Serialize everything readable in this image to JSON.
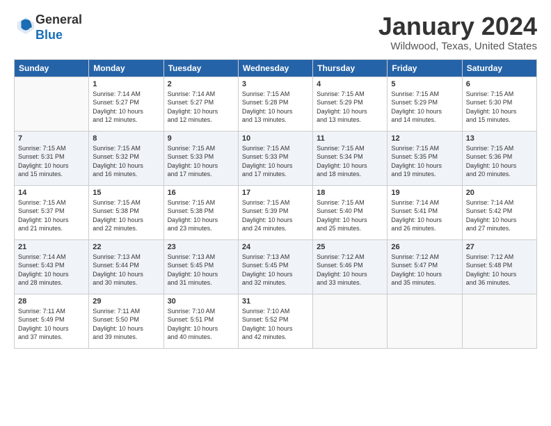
{
  "logo": {
    "general": "General",
    "blue": "Blue"
  },
  "title": "January 2024",
  "subtitle": "Wildwood, Texas, United States",
  "weekdays": [
    "Sunday",
    "Monday",
    "Tuesday",
    "Wednesday",
    "Thursday",
    "Friday",
    "Saturday"
  ],
  "weeks": [
    [
      {
        "day": "",
        "info": ""
      },
      {
        "day": "1",
        "info": "Sunrise: 7:14 AM\nSunset: 5:27 PM\nDaylight: 10 hours\nand 12 minutes."
      },
      {
        "day": "2",
        "info": "Sunrise: 7:14 AM\nSunset: 5:27 PM\nDaylight: 10 hours\nand 12 minutes."
      },
      {
        "day": "3",
        "info": "Sunrise: 7:15 AM\nSunset: 5:28 PM\nDaylight: 10 hours\nand 13 minutes."
      },
      {
        "day": "4",
        "info": "Sunrise: 7:15 AM\nSunset: 5:29 PM\nDaylight: 10 hours\nand 13 minutes."
      },
      {
        "day": "5",
        "info": "Sunrise: 7:15 AM\nSunset: 5:29 PM\nDaylight: 10 hours\nand 14 minutes."
      },
      {
        "day": "6",
        "info": "Sunrise: 7:15 AM\nSunset: 5:30 PM\nDaylight: 10 hours\nand 15 minutes."
      }
    ],
    [
      {
        "day": "7",
        "info": "Sunrise: 7:15 AM\nSunset: 5:31 PM\nDaylight: 10 hours\nand 15 minutes."
      },
      {
        "day": "8",
        "info": "Sunrise: 7:15 AM\nSunset: 5:32 PM\nDaylight: 10 hours\nand 16 minutes."
      },
      {
        "day": "9",
        "info": "Sunrise: 7:15 AM\nSunset: 5:33 PM\nDaylight: 10 hours\nand 17 minutes."
      },
      {
        "day": "10",
        "info": "Sunrise: 7:15 AM\nSunset: 5:33 PM\nDaylight: 10 hours\nand 17 minutes."
      },
      {
        "day": "11",
        "info": "Sunrise: 7:15 AM\nSunset: 5:34 PM\nDaylight: 10 hours\nand 18 minutes."
      },
      {
        "day": "12",
        "info": "Sunrise: 7:15 AM\nSunset: 5:35 PM\nDaylight: 10 hours\nand 19 minutes."
      },
      {
        "day": "13",
        "info": "Sunrise: 7:15 AM\nSunset: 5:36 PM\nDaylight: 10 hours\nand 20 minutes."
      }
    ],
    [
      {
        "day": "14",
        "info": "Sunrise: 7:15 AM\nSunset: 5:37 PM\nDaylight: 10 hours\nand 21 minutes."
      },
      {
        "day": "15",
        "info": "Sunrise: 7:15 AM\nSunset: 5:38 PM\nDaylight: 10 hours\nand 22 minutes."
      },
      {
        "day": "16",
        "info": "Sunrise: 7:15 AM\nSunset: 5:38 PM\nDaylight: 10 hours\nand 23 minutes."
      },
      {
        "day": "17",
        "info": "Sunrise: 7:15 AM\nSunset: 5:39 PM\nDaylight: 10 hours\nand 24 minutes."
      },
      {
        "day": "18",
        "info": "Sunrise: 7:15 AM\nSunset: 5:40 PM\nDaylight: 10 hours\nand 25 minutes."
      },
      {
        "day": "19",
        "info": "Sunrise: 7:14 AM\nSunset: 5:41 PM\nDaylight: 10 hours\nand 26 minutes."
      },
      {
        "day": "20",
        "info": "Sunrise: 7:14 AM\nSunset: 5:42 PM\nDaylight: 10 hours\nand 27 minutes."
      }
    ],
    [
      {
        "day": "21",
        "info": "Sunrise: 7:14 AM\nSunset: 5:43 PM\nDaylight: 10 hours\nand 28 minutes."
      },
      {
        "day": "22",
        "info": "Sunrise: 7:13 AM\nSunset: 5:44 PM\nDaylight: 10 hours\nand 30 minutes."
      },
      {
        "day": "23",
        "info": "Sunrise: 7:13 AM\nSunset: 5:45 PM\nDaylight: 10 hours\nand 31 minutes."
      },
      {
        "day": "24",
        "info": "Sunrise: 7:13 AM\nSunset: 5:45 PM\nDaylight: 10 hours\nand 32 minutes."
      },
      {
        "day": "25",
        "info": "Sunrise: 7:12 AM\nSunset: 5:46 PM\nDaylight: 10 hours\nand 33 minutes."
      },
      {
        "day": "26",
        "info": "Sunrise: 7:12 AM\nSunset: 5:47 PM\nDaylight: 10 hours\nand 35 minutes."
      },
      {
        "day": "27",
        "info": "Sunrise: 7:12 AM\nSunset: 5:48 PM\nDaylight: 10 hours\nand 36 minutes."
      }
    ],
    [
      {
        "day": "28",
        "info": "Sunrise: 7:11 AM\nSunset: 5:49 PM\nDaylight: 10 hours\nand 37 minutes."
      },
      {
        "day": "29",
        "info": "Sunrise: 7:11 AM\nSunset: 5:50 PM\nDaylight: 10 hours\nand 39 minutes."
      },
      {
        "day": "30",
        "info": "Sunrise: 7:10 AM\nSunset: 5:51 PM\nDaylight: 10 hours\nand 40 minutes."
      },
      {
        "day": "31",
        "info": "Sunrise: 7:10 AM\nSunset: 5:52 PM\nDaylight: 10 hours\nand 42 minutes."
      },
      {
        "day": "",
        "info": ""
      },
      {
        "day": "",
        "info": ""
      },
      {
        "day": "",
        "info": ""
      }
    ]
  ]
}
